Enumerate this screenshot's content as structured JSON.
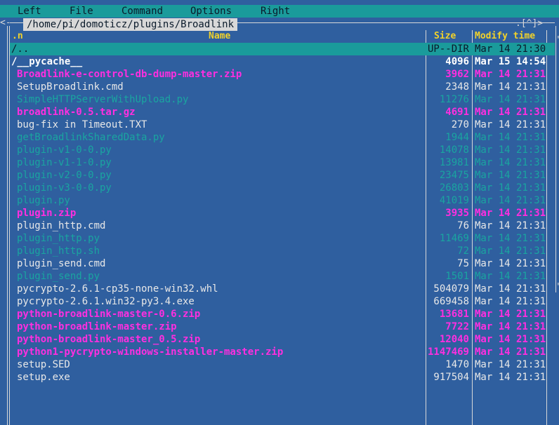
{
  "menu": {
    "items": [
      {
        "label": "Left"
      },
      {
        "label": "File"
      },
      {
        "label": "Command"
      },
      {
        "label": "Options"
      },
      {
        "label": "Right"
      }
    ]
  },
  "panel": {
    "path": "/home/pi/domoticz/plugins/Broadlink",
    "corner_left": "<-",
    "history_hint": ".[^]>",
    "header": {
      "sort_indicator": ".n",
      "name": "Name",
      "size": "Size",
      "mtime": "Modify time"
    },
    "files": [
      {
        "name": "/..",
        "size": "UP--DIR",
        "mtime": "Mar 14 21:30",
        "kind": "updir"
      },
      {
        "name": "/__pycache__",
        "size": "4096",
        "mtime": "Mar 15 14:54",
        "kind": "dir"
      },
      {
        "name": "Broadlink-e-control-db-dump-master.zip",
        "size": "3962",
        "mtime": "Mar 14 21:31",
        "kind": "archive"
      },
      {
        "name": "SetupBroadlink.cmd",
        "size": "2348",
        "mtime": "Mar 14 21:31",
        "kind": "normal"
      },
      {
        "name": "SimpleHTTPServerWithUpload.py",
        "size": "11276",
        "mtime": "Mar 14 21:31",
        "kind": "exec"
      },
      {
        "name": "broadlink-0.5.tar.gz",
        "size": "4691",
        "mtime": "Mar 14 21:31",
        "kind": "archive"
      },
      {
        "name": "bug-fix in Timeout.TXT",
        "size": "270",
        "mtime": "Mar 14 21:31",
        "kind": "normal"
      },
      {
        "name": "getBroadlinkSharedData.py",
        "size": "1944",
        "mtime": "Mar 14 21:31",
        "kind": "exec"
      },
      {
        "name": "plugin-v1-0-0.py",
        "size": "14078",
        "mtime": "Mar 14 21:31",
        "kind": "exec"
      },
      {
        "name": "plugin-v1-1-0.py",
        "size": "13981",
        "mtime": "Mar 14 21:31",
        "kind": "exec"
      },
      {
        "name": "plugin-v2-0-0.py",
        "size": "23475",
        "mtime": "Mar 14 21:31",
        "kind": "exec"
      },
      {
        "name": "plugin-v3-0-0.py",
        "size": "26803",
        "mtime": "Mar 14 21:31",
        "kind": "exec"
      },
      {
        "name": "plugin.py",
        "size": "41019",
        "mtime": "Mar 14 21:31",
        "kind": "exec"
      },
      {
        "name": "plugin.zip",
        "size": "3935",
        "mtime": "Mar 14 21:31",
        "kind": "archive"
      },
      {
        "name": "plugin_http.cmd",
        "size": "76",
        "mtime": "Mar 14 21:31",
        "kind": "normal"
      },
      {
        "name": "plugin_http.py",
        "size": "11469",
        "mtime": "Mar 14 21:31",
        "kind": "exec"
      },
      {
        "name": "plugin_http.sh",
        "size": "72",
        "mtime": "Mar 14 21:31",
        "kind": "exec"
      },
      {
        "name": "plugin_send.cmd",
        "size": "75",
        "mtime": "Mar 14 21:31",
        "kind": "normal"
      },
      {
        "name": "plugin_send.py",
        "size": "1501",
        "mtime": "Mar 14 21:31",
        "kind": "exec"
      },
      {
        "name": "pycrypto-2.6.1-cp35-none-win32.whl",
        "size": "504079",
        "mtime": "Mar 14 21:31",
        "kind": "normal"
      },
      {
        "name": "pycrypto-2.6.1.win32-py3.4.exe",
        "size": "669458",
        "mtime": "Mar 14 21:31",
        "kind": "normal"
      },
      {
        "name": "python-broadlink-master-0.6.zip",
        "size": "13681",
        "mtime": "Mar 14 21:31",
        "kind": "archive"
      },
      {
        "name": "python-broadlink-master.zip",
        "size": "7722",
        "mtime": "Mar 14 21:31",
        "kind": "archive"
      },
      {
        "name": "python-broadlink-master_0.5.zip",
        "size": "12040",
        "mtime": "Mar 14 21:31",
        "kind": "archive"
      },
      {
        "name": "python1-pycrypto-windows-installer-master.zip",
        "size": "1147469",
        "mtime": "Mar 14 21:31",
        "kind": "archive"
      },
      {
        "name": "setup.SED",
        "size": "1470",
        "mtime": "Mar 14 21:31",
        "kind": "normal"
      },
      {
        "name": "setup.exe",
        "size": "917504",
        "mtime": "Mar 14 21:31",
        "kind": "normal"
      }
    ]
  },
  "colors": {
    "panel_bg": "#2f5f9f",
    "menubar_bg": "#1a9b9b",
    "header_fg": "#f2d22a",
    "archive_fg": "#ff2ee0",
    "exec_fg": "#1aa5a0",
    "normal_fg": "#e8e8e8"
  }
}
